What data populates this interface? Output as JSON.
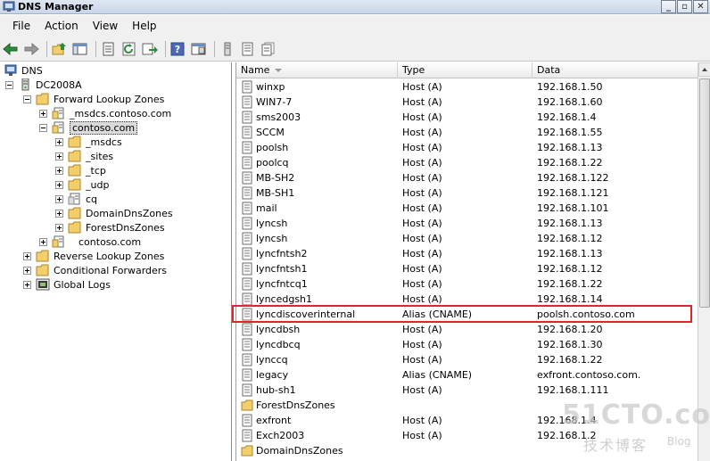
{
  "window": {
    "title": "DNS Manager",
    "buttons": {
      "minimize": "_",
      "restore": "▫",
      "close": "✕"
    }
  },
  "menu": [
    "File",
    "Action",
    "View",
    "Help"
  ],
  "toolbar": [
    "back-arrow-icon",
    "forward-arrow-icon",
    "up-folder-icon",
    "show-hide-tree-icon",
    "properties-icon",
    "refresh-icon",
    "export-icon",
    "help-icon",
    "console-icon",
    "server-icon",
    "zone-icon",
    "record-icon"
  ],
  "tree": {
    "root": "DNS",
    "server": "DC2008A",
    "forward": "Forward Lookup Zones",
    "msdcs_zone": "_msdcs.contoso.com",
    "contoso": "contoso.com",
    "msdcs": "_msdcs",
    "sites": "_sites",
    "tcp": "_tcp",
    "udp": "_udp",
    "cq": "cq",
    "domaindns": "DomainDnsZones",
    "forestdns": "ForestDnsZones",
    "other_zone": "contoso.com",
    "reverse": "Reverse Lookup Zones",
    "conditional": "Conditional Forwarders",
    "globallogs": "Global Logs"
  },
  "list": {
    "headers": {
      "name": "Name",
      "type": "Type",
      "data": "Data"
    },
    "rows": [
      {
        "name": "winxp",
        "type": "Host (A)",
        "data": "192.168.1.50",
        "icon": "record-icon"
      },
      {
        "name": "WIN7-7",
        "type": "Host (A)",
        "data": "192.168.1.60",
        "icon": "record-icon"
      },
      {
        "name": "sms2003",
        "type": "Host (A)",
        "data": "192.168.1.4",
        "icon": "record-icon"
      },
      {
        "name": "SCCM",
        "type": "Host (A)",
        "data": "192.168.1.55",
        "icon": "record-icon"
      },
      {
        "name": "poolsh",
        "type": "Host (A)",
        "data": "192.168.1.13",
        "icon": "record-icon"
      },
      {
        "name": "poolcq",
        "type": "Host (A)",
        "data": "192.168.1.22",
        "icon": "record-icon"
      },
      {
        "name": "MB-SH2",
        "type": "Host (A)",
        "data": "192.168.1.122",
        "icon": "record-icon"
      },
      {
        "name": "MB-SH1",
        "type": "Host (A)",
        "data": "192.168.1.121",
        "icon": "record-icon"
      },
      {
        "name": "mail",
        "type": "Host (A)",
        "data": "192.168.1.101",
        "icon": "record-icon"
      },
      {
        "name": "lyncsh",
        "type": "Host (A)",
        "data": "192.168.1.13",
        "icon": "record-icon"
      },
      {
        "name": "lyncsh",
        "type": "Host (A)",
        "data": "192.168.1.12",
        "icon": "record-icon"
      },
      {
        "name": "lyncfntsh2",
        "type": "Host (A)",
        "data": "192.168.1.13",
        "icon": "record-icon"
      },
      {
        "name": "lyncfntsh1",
        "type": "Host (A)",
        "data": "192.168.1.12",
        "icon": "record-icon"
      },
      {
        "name": "lyncfntcq1",
        "type": "Host (A)",
        "data": "192.168.1.22",
        "icon": "record-icon"
      },
      {
        "name": "lyncedgsh1",
        "type": "Host (A)",
        "data": "192.168.1.14",
        "icon": "record-icon"
      },
      {
        "name": "lyncdiscoverinternal",
        "type": "Alias (CNAME)",
        "data": "poolsh.contoso.com",
        "icon": "record-icon"
      },
      {
        "name": "lyncdbsh",
        "type": "Host (A)",
        "data": "192.168.1.20",
        "icon": "record-icon"
      },
      {
        "name": "lyncdbcq",
        "type": "Host (A)",
        "data": "192.168.1.30",
        "icon": "record-icon"
      },
      {
        "name": "lynccq",
        "type": "Host (A)",
        "data": "192.168.1.22",
        "icon": "record-icon"
      },
      {
        "name": "legacy",
        "type": "Alias (CNAME)",
        "data": "exfront.contoso.com.",
        "icon": "record-icon"
      },
      {
        "name": "hub-sh1",
        "type": "Host (A)",
        "data": "192.168.1.111",
        "icon": "record-icon"
      },
      {
        "name": "ForestDnsZones",
        "type": "",
        "data": "",
        "icon": "folder-icon"
      },
      {
        "name": "exfront",
        "type": "Host (A)",
        "data": "192.168.1.4",
        "icon": "record-icon"
      },
      {
        "name": "Exch2003",
        "type": "Host (A)",
        "data": "192.168.1.2",
        "icon": "record-icon"
      },
      {
        "name": "DomainDnsZones",
        "type": "",
        "data": "",
        "icon": "folder-icon"
      }
    ]
  },
  "watermark": {
    "main": "51CTO.com",
    "sub": "技术博客",
    "blog": "Blog"
  },
  "colors": {
    "highlight": "#e0262a",
    "folder": "#f2cf6b"
  }
}
